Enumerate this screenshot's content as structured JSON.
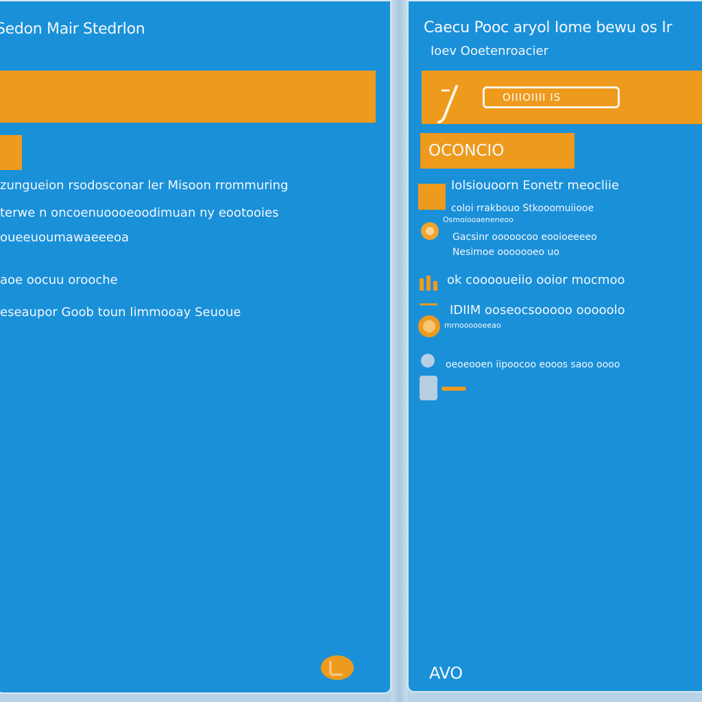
{
  "left": {
    "title": "Sedon Mair Stedrlon",
    "lines": [
      "zungueion rsodosconar ler Misoon rrommuring",
      "terwe n oncoenuoooeoodimuan ny eootooies",
      "oueeuoumawaeeeoa",
      "aoe oocuu orooche",
      "eseaupor Goob toun Iimmooay Seuoue"
    ]
  },
  "right": {
    "title": "Caecu Pooc aryol Iome bewu os Ir",
    "subtitle": "Ioev Ooetenroacier",
    "input_text": "OIIIOIIII IS",
    "button_label": "OCONCIO",
    "items": [
      {
        "text": "Iolsiouoorn Eonetr meocliie"
      },
      {
        "text": "coloi rrakbouo Stkooomuiiooe",
        "sub": "Osmoiooaeneneoo"
      },
      {
        "text": "Gacsinr ooooocoo eooioeeeeo",
        "sub": "Nesimoe ooooooeo uo"
      },
      {
        "text": "ok cooooueiio ooior mocmoo"
      },
      {
        "text": "IDIIM ooseocsooooo ooooolo",
        "sub": "mrnoooooeeao"
      },
      {
        "text": "oeoeooen iipoocoo eooos saoo oooo"
      }
    ],
    "footer": "AVO"
  },
  "colors": {
    "panel": "#1a90d9",
    "accent": "#ee9a1c",
    "text": "#f3f8fc"
  }
}
